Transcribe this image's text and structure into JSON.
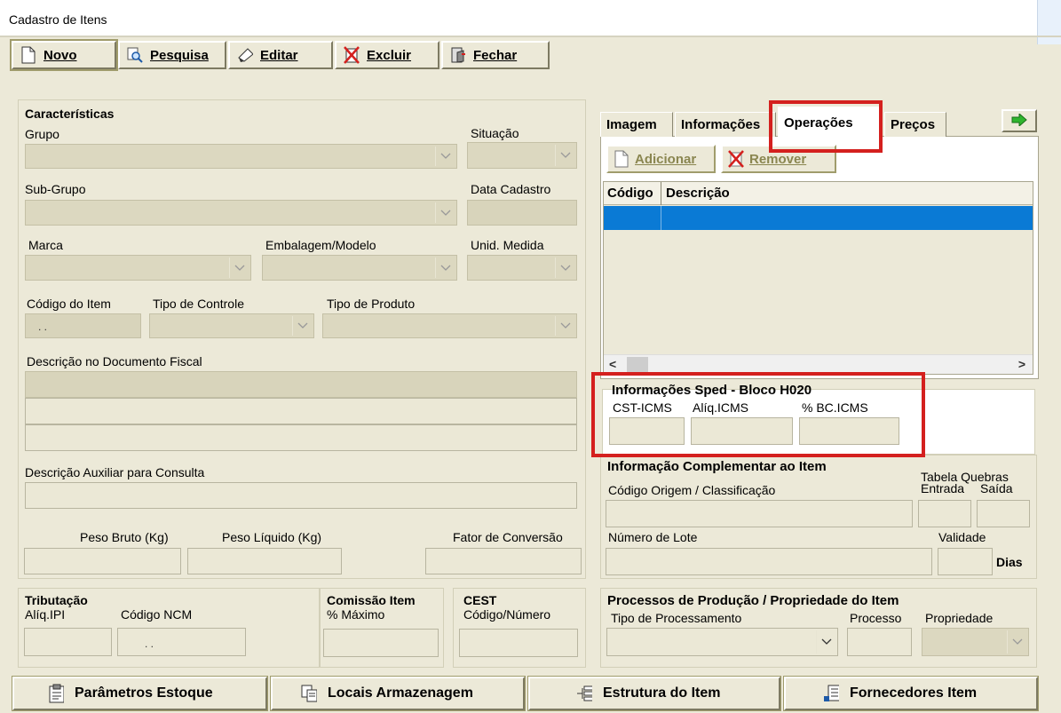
{
  "window": {
    "title": "Cadastro de Itens"
  },
  "toolbar": {
    "novo": "Novo",
    "pesquisa": "Pesquisa",
    "editar": "Editar",
    "excluir": "Excluir",
    "fechar": "Fechar"
  },
  "caracteristicas": {
    "title": "Características",
    "grupo": "Grupo",
    "situacao": "Situação",
    "subgrupo": "Sub-Grupo",
    "data_cadastro": "Data Cadastro",
    "marca": "Marca",
    "embalagem": "Embalagem/Modelo",
    "unid_medida": "Unid. Medida",
    "codigo_item": "Código do Item",
    "codigo_item_mask": " .  .",
    "tipo_controle": "Tipo de Controle",
    "tipo_produto": "Tipo de Produto",
    "descricao_fiscal": "Descrição no Documento Fiscal",
    "descricao_aux": "Descrição Auxiliar para Consulta",
    "peso_bruto": "Peso Bruto (Kg)",
    "peso_liquido": "Peso Líquido (Kg)",
    "fator_conversao": "Fator de Conversão"
  },
  "tributacao": {
    "title": "Tributação",
    "aliq_ipi": "Alíq.IPI",
    "codigo_ncm": "Código NCM",
    "ncm_mask": ".  ."
  },
  "comissao": {
    "title": "Comissão Item",
    "maximo": "% Máximo"
  },
  "cest": {
    "title": "CEST",
    "codigo": "Código/Número"
  },
  "tabs": {
    "imagem": "Imagem",
    "informacoes": "Informações",
    "operacoes": "Operações",
    "precos": "Preços"
  },
  "operacoes": {
    "adicionar": "Adicionar",
    "remover": "Remover",
    "col_codigo": "Código",
    "col_descricao": "Descrição"
  },
  "sped": {
    "title": "Informações Sped - Bloco H020",
    "cst": "CST-ICMS",
    "aliq": "Alíq.ICMS",
    "bc": "% BC.ICMS"
  },
  "complementar": {
    "title": "Informação Complementar ao Item",
    "codigo_origem": "Código Origem / Classificação",
    "tabela_quebras": "Tabela Quebras",
    "entrada": "Entrada",
    "saida": "Saída",
    "numero_lote": "Número de Lote",
    "validade": "Validade",
    "dias": "Dias"
  },
  "processos": {
    "title": "Processos de Produção / Propriedade do Item",
    "tipo": "Tipo de Processamento",
    "processo": "Processo",
    "propriedade": "Propriedade"
  },
  "bottom": {
    "parametros": "Parâmetros Estoque",
    "locais": "Locais Armazenagem",
    "estrutura": "Estrutura do Item",
    "fornecedores": "Fornecedores Item"
  },
  "colors": {
    "highlight": "#d4201e",
    "selection": "#0a7ad5",
    "background": "#ece9d8"
  }
}
